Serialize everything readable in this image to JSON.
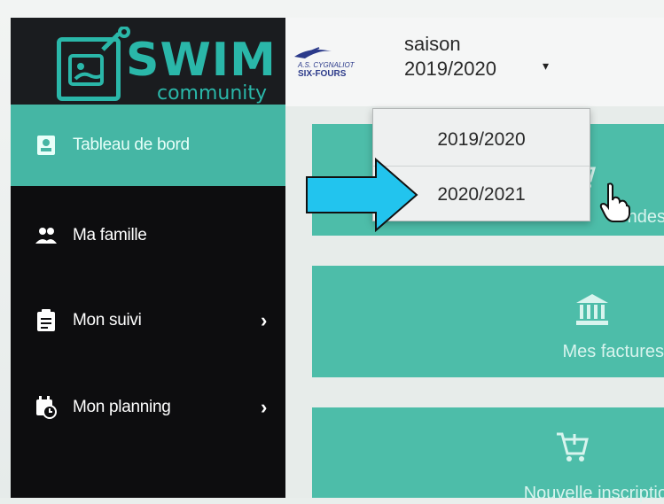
{
  "brand": {
    "name": "SWIM",
    "tagline": "community",
    "color": "#2ab7a9",
    "icon": "swim-community-logo-icon"
  },
  "club": {
    "logo_text_top": "A.S. CYGNALIOTS",
    "logo_text_bottom": "SIX-FOURS"
  },
  "header": {
    "season_label": "saison",
    "season_value": "2019/2020",
    "season_caret": "▾"
  },
  "season_dropdown": {
    "options": [
      "2019/2020",
      "2020/2021"
    ],
    "hovered_index": 1
  },
  "sidebar": {
    "items": [
      {
        "label": "Tableau de bord",
        "icon": "id-badge-icon",
        "active": true,
        "chevron": ""
      },
      {
        "label": "Ma famille",
        "icon": "users-icon",
        "active": false,
        "chevron": ""
      },
      {
        "label": "Mon suivi",
        "icon": "clipboard-icon",
        "active": false,
        "chevron": "›"
      },
      {
        "label": "Mon planning",
        "icon": "calendar-clock-icon",
        "active": false,
        "chevron": "›"
      }
    ]
  },
  "cards": [
    {
      "label": "ndes",
      "icon": "cart-icon"
    },
    {
      "label": "Mes factures",
      "icon": "bank-icon"
    },
    {
      "label": "Nouvelle inscriptio",
      "icon": "cart-plus-icon"
    }
  ],
  "annotation": {
    "arrow_color": "#22c4ee",
    "arrow_icon": "right-arrow-icon"
  },
  "colors": {
    "accent": "#4dbda9",
    "active_nav": "#45b6a4",
    "sidebar_bg": "#0d0d0f"
  }
}
